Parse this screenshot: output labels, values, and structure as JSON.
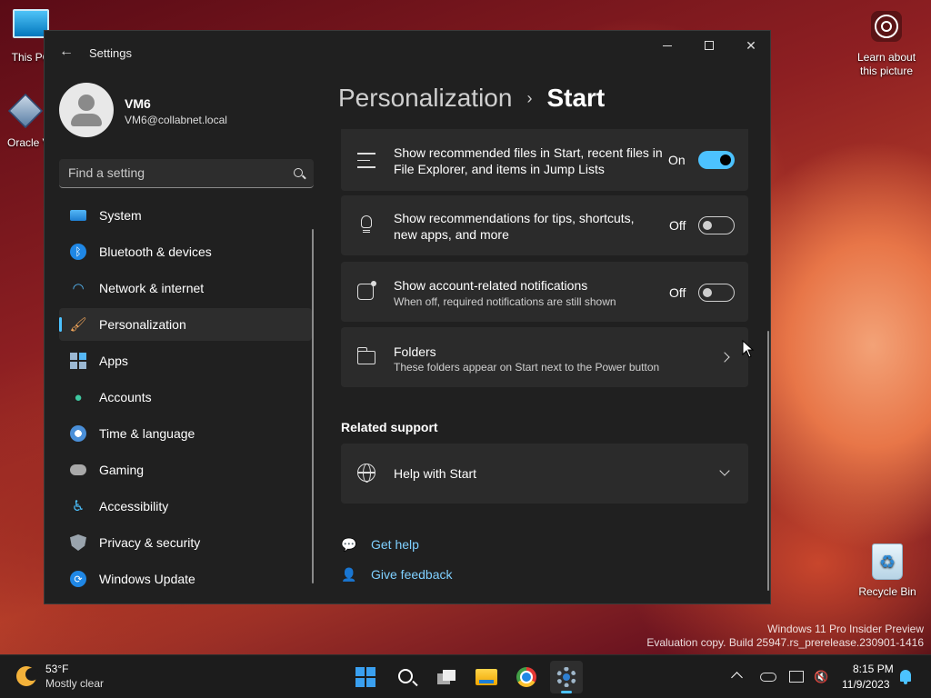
{
  "desktop": {
    "icons": [
      {
        "label": "This PC"
      },
      {
        "label": "Oracle VirtualBox"
      },
      {
        "label": "Learn about this picture"
      },
      {
        "label": "Recycle Bin"
      }
    ],
    "watermark_line1": "Windows 11 Pro Insider Preview",
    "watermark_line2": "Evaluation copy. Build 25947.rs_prerelease.230901-1416"
  },
  "window": {
    "title": "Settings",
    "controls": {
      "minimize": "minimize",
      "maximize": "maximize",
      "close": "close"
    }
  },
  "profile": {
    "name": "VM6",
    "email": "VM6@collabnet.local"
  },
  "search": {
    "placeholder": "Find a setting"
  },
  "nav": {
    "items": [
      {
        "label": "System",
        "icon": "monitor-icon"
      },
      {
        "label": "Bluetooth & devices",
        "icon": "bluetooth-icon"
      },
      {
        "label": "Network & internet",
        "icon": "wifi-icon"
      },
      {
        "label": "Personalization",
        "icon": "brush-icon",
        "active": true
      },
      {
        "label": "Apps",
        "icon": "apps-icon"
      },
      {
        "label": "Accounts",
        "icon": "person-icon"
      },
      {
        "label": "Time & language",
        "icon": "clock-globe-icon"
      },
      {
        "label": "Gaming",
        "icon": "controller-icon"
      },
      {
        "label": "Accessibility",
        "icon": "accessibility-icon"
      },
      {
        "label": "Privacy & security",
        "icon": "shield-icon"
      },
      {
        "label": "Windows Update",
        "icon": "update-icon"
      }
    ]
  },
  "breadcrumb": {
    "parent": "Personalization",
    "separator": "›",
    "current": "Start"
  },
  "settings": {
    "recommended_files": {
      "title": "Show recommended files in Start, recent files in File Explorer, and items in Jump Lists",
      "state_label": "On",
      "on": true
    },
    "recommendations": {
      "title": "Show recommendations for tips, shortcuts, new apps, and more",
      "state_label": "Off",
      "on": false
    },
    "account_notifications": {
      "title": "Show account-related notifications",
      "subtitle": "When off, required notifications are still shown",
      "state_label": "Off",
      "on": false
    },
    "folders": {
      "title": "Folders",
      "subtitle": "These folders appear on Start next to the Power button"
    }
  },
  "related_support": {
    "heading": "Related support",
    "help_title": "Help with Start"
  },
  "links": {
    "get_help": "Get help",
    "give_feedback": "Give feedback"
  },
  "taskbar": {
    "weather_temp": "53°F",
    "weather_desc": "Mostly clear",
    "time": "8:15 PM",
    "date": "11/9/2023",
    "apps": [
      "start-icon",
      "search-icon",
      "task-view-icon",
      "file-explorer-icon",
      "chrome-icon",
      "settings-icon"
    ]
  },
  "colors": {
    "accent": "#4cc2ff",
    "window_bg": "#202020",
    "card_bg": "#2b2b2b",
    "link": "#7fd0ff"
  }
}
